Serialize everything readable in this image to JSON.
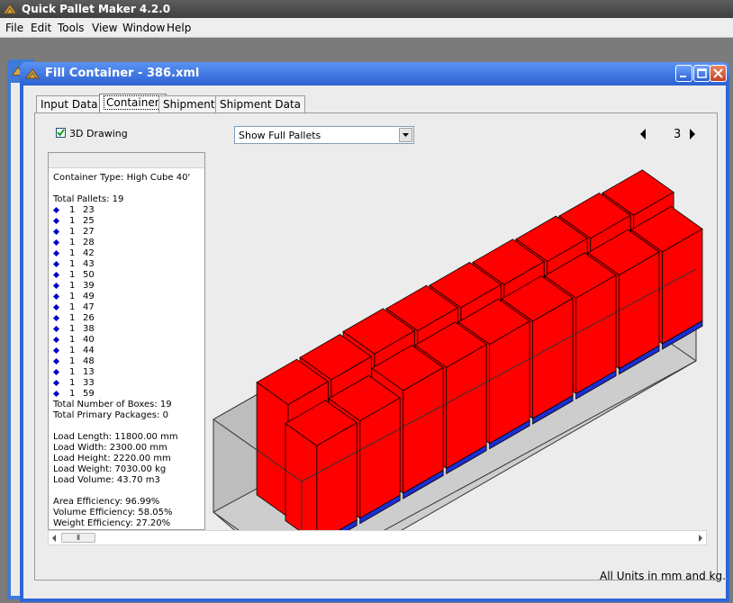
{
  "app": {
    "title": "Quick Pallet Maker 4.2.0"
  },
  "menu": [
    "File",
    "Edit",
    "Tools",
    "View",
    "Window",
    "Help"
  ],
  "window": {
    "title": "Fill Container - 386.xml"
  },
  "tabs": [
    "Input Data",
    "Container",
    "Shipment",
    "Shipment Data"
  ],
  "active_tab": "Container",
  "drawing_3d": {
    "label": "3D Drawing",
    "checked": true
  },
  "view_select": {
    "value": "Show Full Pallets"
  },
  "pager": {
    "current": "3"
  },
  "info": {
    "container_type": "Container Type: High Cube 40'",
    "total_pallets": "Total Pallets: 19",
    "pallets": [
      {
        "qty": "1",
        "id": "23"
      },
      {
        "qty": "1",
        "id": "25"
      },
      {
        "qty": "1",
        "id": "27"
      },
      {
        "qty": "1",
        "id": "28"
      },
      {
        "qty": "1",
        "id": "42"
      },
      {
        "qty": "1",
        "id": "43"
      },
      {
        "qty": "1",
        "id": "50"
      },
      {
        "qty": "1",
        "id": "39"
      },
      {
        "qty": "1",
        "id": "49"
      },
      {
        "qty": "1",
        "id": "47"
      },
      {
        "qty": "1",
        "id": "26"
      },
      {
        "qty": "1",
        "id": "38"
      },
      {
        "qty": "1",
        "id": "40"
      },
      {
        "qty": "1",
        "id": "44"
      },
      {
        "qty": "1",
        "id": "48"
      },
      {
        "qty": "1",
        "id": "13"
      },
      {
        "qty": "1",
        "id": "33"
      },
      {
        "qty": "1",
        "id": "59"
      }
    ],
    "total_boxes": "Total Number of Boxes: 19",
    "total_primary": "Total Primary Packages: 0",
    "load_length": "Load Length: 11800.00 mm",
    "load_width": "Load Width: 2300.00 mm",
    "load_height": "Load Height: 2220.00 mm",
    "load_weight": "Load Weight: 7030.00 kg",
    "load_volume": "Load Volume: 43.70 m3",
    "area_eff": "Area Efficiency: 96.99%",
    "volume_eff": "Volume Efficiency: 58.05%",
    "weight_eff": "Weight Efficiency: 27.20%"
  },
  "status": "All Units in mm and kg.",
  "colors": {
    "box": "#ff0000",
    "pallet": "#1e2fd0",
    "bullet": "#0000cc",
    "container": "#c8c8c8"
  }
}
